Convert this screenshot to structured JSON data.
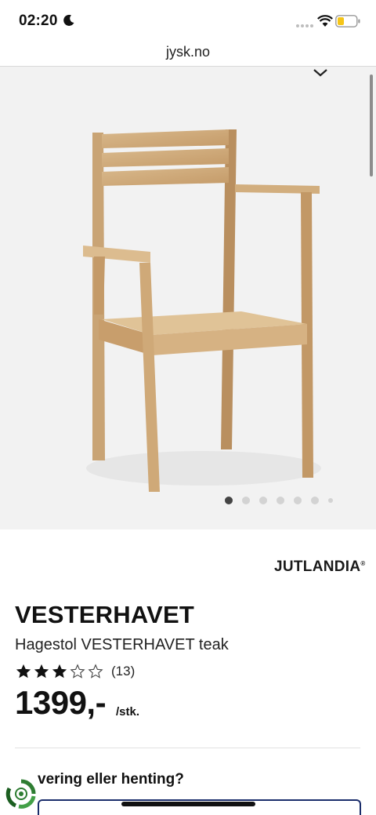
{
  "status": {
    "time": "02:20",
    "icons": [
      "moon-icon",
      "signal-icon",
      "wifi-icon",
      "battery-icon"
    ]
  },
  "browser": {
    "url": "jysk.no"
  },
  "gallery": {
    "image": "teak-garden-chair",
    "slide_count": 7,
    "active_index": 0
  },
  "product": {
    "brand": "JUTLANDIA",
    "brand_mark": "®",
    "name": "VESTERHAVET",
    "description": "Hagestol VESTERHAVET teak",
    "rating": 3,
    "rating_max": 5,
    "review_count": "(13)",
    "price": "1399,-",
    "unit": "/stk."
  },
  "delivery": {
    "heading": "vering eller henting?"
  },
  "colors": {
    "hero_bg": "#f2f2f2",
    "select_border": "#1a2d6b",
    "eco_badge": "#2e7d32"
  }
}
